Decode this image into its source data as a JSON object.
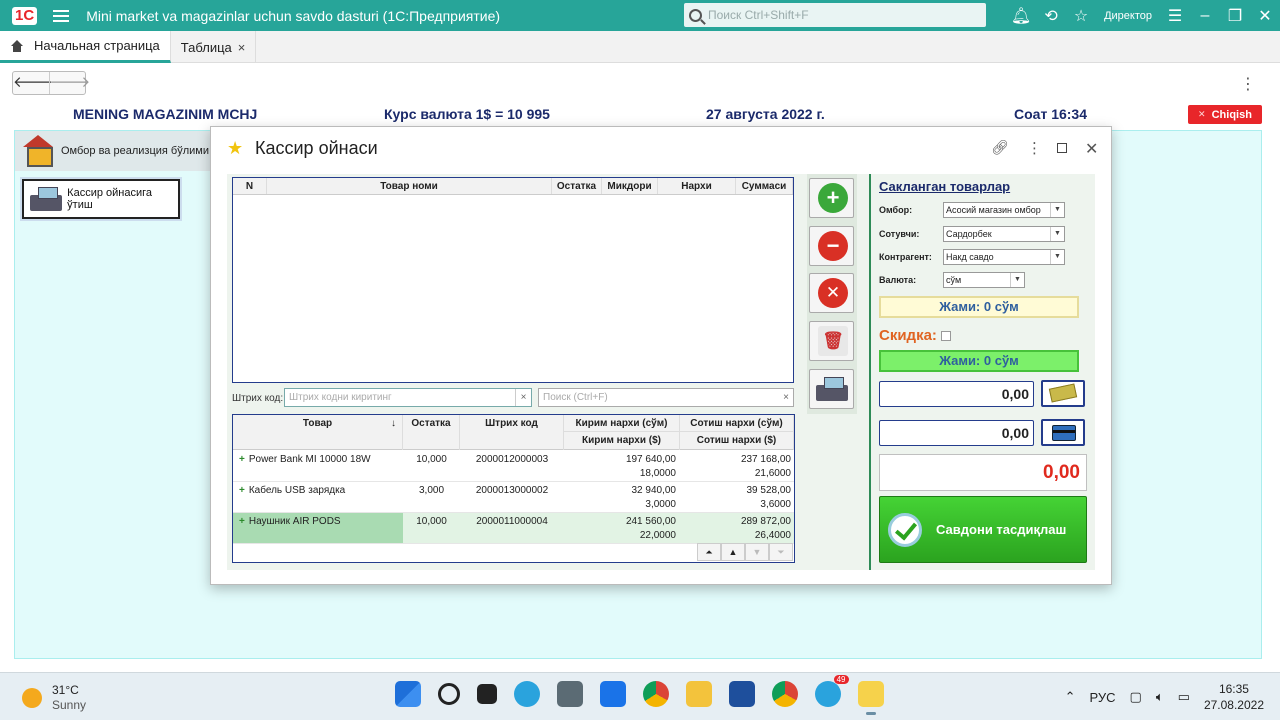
{
  "titlebar": {
    "logo": "1С",
    "title": "Mini market va magazinlar uchun savdo dasturi  (1С:Предприятие)",
    "search_placeholder": "Поиск Ctrl+Shift+F",
    "user": "Директор"
  },
  "tabs": [
    {
      "label": "Начальная страница"
    },
    {
      "label": "Таблица",
      "close": "×"
    }
  ],
  "nav": {
    "back": "🡐",
    "forward": "🡒"
  },
  "header": {
    "company": "MENING MAGAZINIM MCHJ",
    "rate": "Курс валюта 1$ = 10 995",
    "date": "27 августа 2022 г.",
    "time": "Соат 16:34",
    "exit_label": "Chiqish"
  },
  "sidebar": {
    "section_label": "Омбор ва реализция бўлими",
    "cashier_link": "Кассир ойнасига ўтиш"
  },
  "dialog": {
    "title": "Кассир ойнаси",
    "cart_columns": [
      "N",
      "Товар номи",
      "Остатка",
      "Микдори",
      "Нархи",
      "Суммаси"
    ],
    "barcode_label": "Штрих код:",
    "barcode_placeholder": "Штрих кодни киритинг",
    "search_placeholder": "Поиск (Ctrl+F)",
    "clear": "×",
    "product_columns": {
      "name": "Товар",
      "stock": "Остатка",
      "barcode": "Штрих код",
      "buy_uzs": "Кирим нархи (сўм)",
      "sell_uzs": "Сотиш нархи (сўм)",
      "buy_usd": "Кирим нархи ($)",
      "sell_usd": "Сотиш нархи ($)",
      "sort": "↓"
    },
    "products": [
      {
        "name": "Power Bank MI 10000 18W",
        "stock": "10,000",
        "barcode": "2000012000003",
        "buy_uzs": "197 640,00",
        "sell_uzs": "237 168,00",
        "buy_usd": "18,0000",
        "sell_usd": "21,6000"
      },
      {
        "name": "Кабель USB зарядка",
        "stock": "3,000",
        "barcode": "2000013000002",
        "buy_uzs": "32 940,00",
        "sell_uzs": "39 528,00",
        "buy_usd": "3,0000",
        "sell_usd": "3,6000"
      },
      {
        "name": "Наушник AIR PODS",
        "stock": "10,000",
        "barcode": "2000011000004",
        "buy_uzs": "241 560,00",
        "sell_uzs": "289 872,00",
        "buy_usd": "22,0000",
        "sell_usd": "26,4000"
      }
    ],
    "pager": [
      "⏶",
      "▲",
      "▼",
      "⏷"
    ],
    "right": {
      "saved_title": "Сакланган товарлар",
      "warehouse_label": "Омбор:",
      "warehouse_value": "Асосий магазин омбор",
      "seller_label": "Сотувчи:",
      "seller_value": "Сардорбек",
      "counterparty_label": "Контрагент:",
      "counterparty_value": "Накд савдо",
      "currency_label": "Валюта:",
      "currency_value": "сўм",
      "total_label": "Жами: 0 сўм",
      "discount_label": "Скидка:",
      "discount_total_label": "Жами: 0 сўм",
      "cash_amount": "0,00",
      "card_amount": "0,00",
      "change_amount": "0,00",
      "confirm_label": "Савдони тасдиқлаш"
    }
  },
  "taskbar": {
    "temp": "31°C",
    "weather": "Sunny",
    "lang": "РУС",
    "time": "16:35",
    "date": "27.08.2022",
    "badge": "49"
  }
}
